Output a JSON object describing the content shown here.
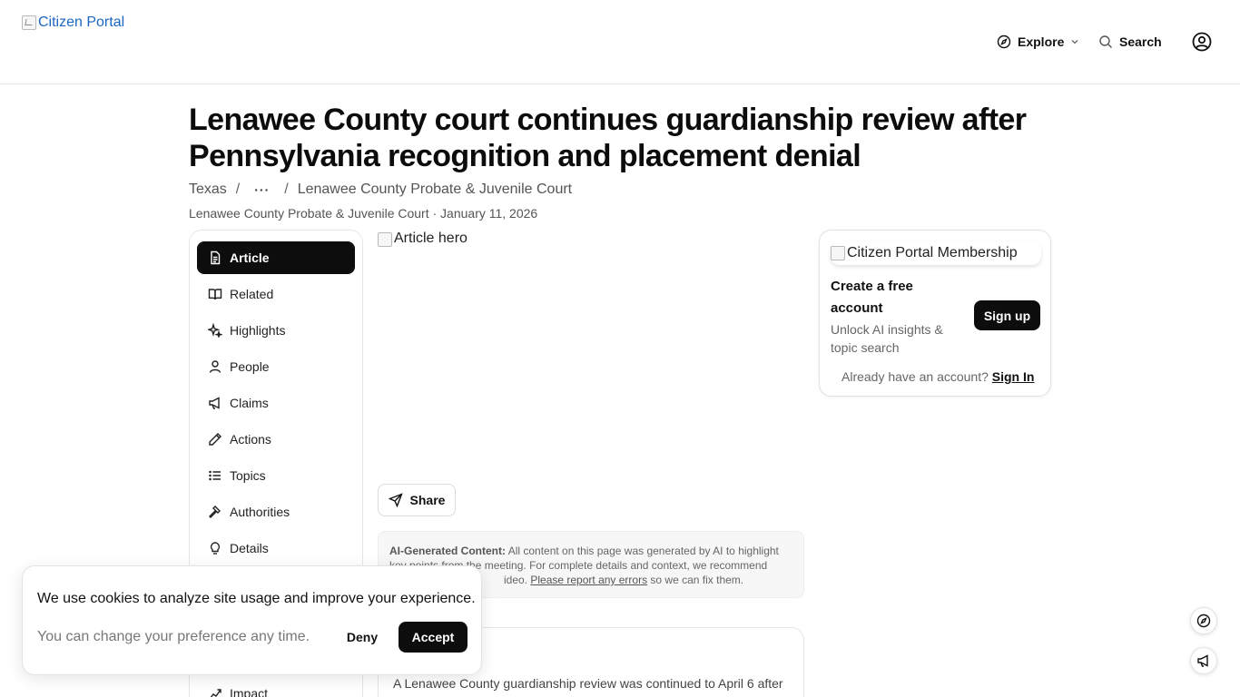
{
  "header": {
    "logo_alt": "Citizen Portal",
    "explore_label": "Explore",
    "search_label": "Search"
  },
  "article": {
    "title": "Lenawee County court continues guardianship review after Pennsylvania recognition and placement denial",
    "breadcrumb": {
      "state": "Texas",
      "ellipsis": "···",
      "court": "Lenawee County Probate & Juvenile Court"
    },
    "byline": "Lenawee County Probate & Juvenile Court · January 11, 2026",
    "hero_alt": "Article hero",
    "share_label": "Share",
    "ai_note": {
      "label": "AI-Generated Content:",
      "text_1": " All content on this page was generated by AI to highlight key points from the meeting. For complete details and context, we recommend",
      "text_2": "ideo. ",
      "link": "Please report any errors",
      "text_3": " so we can fix them."
    },
    "summary": "A Lenawee County guardianship review was continued to April 6 after"
  },
  "sidebar": {
    "items": [
      {
        "label": "Article",
        "icon": "document-icon"
      },
      {
        "label": "Related",
        "icon": "book-icon"
      },
      {
        "label": "Highlights",
        "icon": "sparkles-icon"
      },
      {
        "label": "People",
        "icon": "person-icon"
      },
      {
        "label": "Claims",
        "icon": "megaphone-icon"
      },
      {
        "label": "Actions",
        "icon": "pencil-icon"
      },
      {
        "label": "Topics",
        "icon": "list-icon"
      },
      {
        "label": "Authorities",
        "icon": "gavel-icon"
      },
      {
        "label": "Details",
        "icon": "lightbulb-icon"
      },
      {
        "label": "Impact",
        "icon": "chart-icon"
      }
    ]
  },
  "membership": {
    "image_alt": "Citizen Portal Membership",
    "heading": "Create a free account",
    "subtext": "Unlock AI insights & topic search",
    "signup_label": "Sign up",
    "already_text": "Already have an account?",
    "signin_label": "Sign In"
  },
  "cookie": {
    "message": "We use cookies to analyze site usage and improve your experience.",
    "preference": "You can change your preference any time.",
    "deny_label": "Deny",
    "accept_label": "Accept"
  }
}
